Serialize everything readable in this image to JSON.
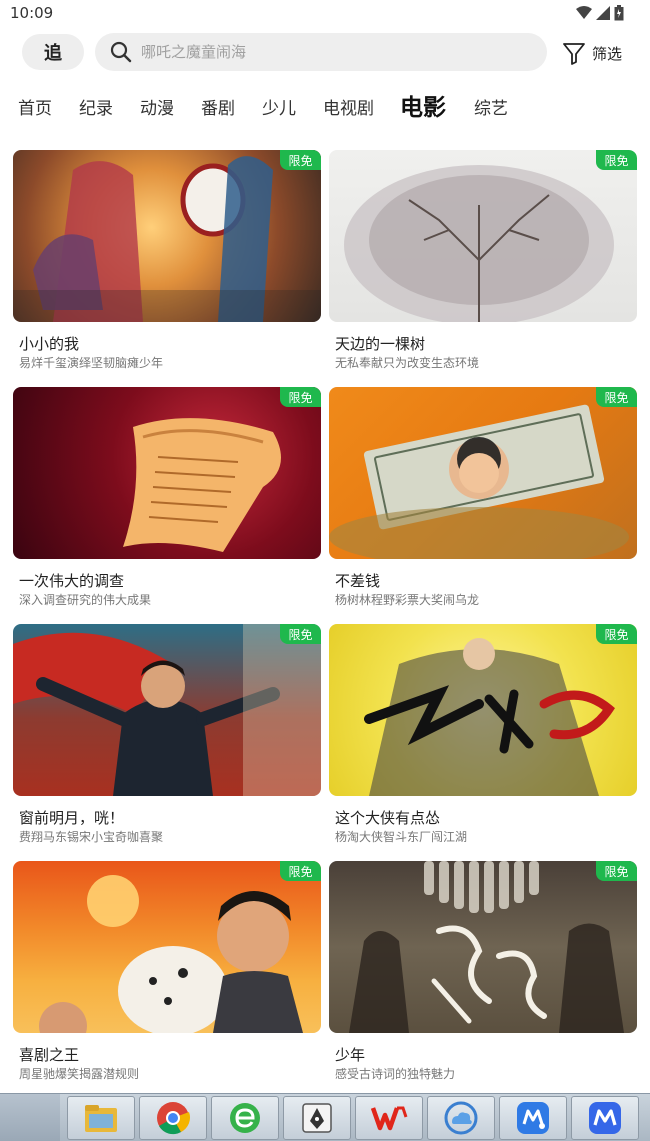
{
  "status": {
    "time": "10:09"
  },
  "header": {
    "chase_label": "追",
    "search_placeholder": "哪吒之魔童闹海",
    "filter_label": "筛选"
  },
  "tabs": [
    {
      "label": "首页"
    },
    {
      "label": "纪录"
    },
    {
      "label": "动漫"
    },
    {
      "label": "番剧"
    },
    {
      "label": "少儿"
    },
    {
      "label": "电视剧"
    },
    {
      "label": "电影",
      "active": true
    },
    {
      "label": "综艺"
    }
  ],
  "badge_label": "限免",
  "accent_color": "#1fb84d",
  "cards": [
    {
      "title": "小小的我",
      "subtitle": "易烊千玺演绎坚韧脑瘫少年"
    },
    {
      "title": "天边的一棵树",
      "subtitle": "无私奉献只为改变生态环境"
    },
    {
      "title": "一次伟大的调查",
      "subtitle": "深入调查研究的伟大成果"
    },
    {
      "title": "不差钱",
      "subtitle": "杨树林程野彩票大奖闹乌龙"
    },
    {
      "title": "窗前明月，咣！",
      "subtitle": "费翔马东锡宋小宝奇咖喜聚"
    },
    {
      "title": "这个大侠有点怂",
      "subtitle": "杨淘大侠智斗东厂闯江湖"
    },
    {
      "title": "喜剧之王",
      "subtitle": "周星驰爆笑揭露潜规则"
    },
    {
      "title": "少年",
      "subtitle": "感受古诗词的独特魅力"
    }
  ],
  "taskbar": [
    {
      "icon": "file-manager-icon"
    },
    {
      "icon": "chrome-icon"
    },
    {
      "icon": "browser-e-icon"
    },
    {
      "icon": "pen-tool-icon"
    },
    {
      "icon": "wps-icon"
    },
    {
      "icon": "cloud-icon"
    },
    {
      "icon": "meeting-icon"
    },
    {
      "icon": "memo-icon"
    }
  ]
}
